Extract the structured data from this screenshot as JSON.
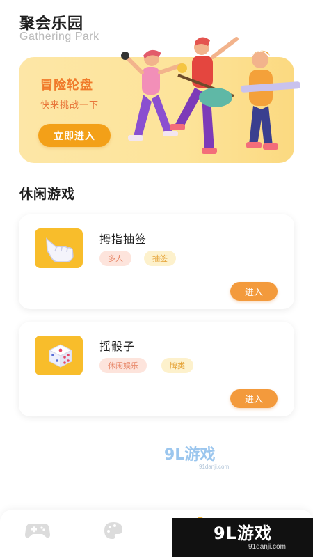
{
  "header": {
    "title": "聚会乐园",
    "subtitle": "Gathering Park"
  },
  "banner": {
    "title": "冒险轮盘",
    "subtitle": "快来挑战一下",
    "button_label": "立即进入"
  },
  "section": {
    "title": "休闲游戏"
  },
  "games": [
    {
      "name": "拇指抽签",
      "tags": [
        "多人",
        "抽签"
      ],
      "enter_label": "进入",
      "icon": "pointing-hand-icon"
    },
    {
      "name": "摇骰子",
      "tags": [
        "休闲娱乐",
        "牌类"
      ],
      "enter_label": "进入",
      "icon": "dice-icon"
    }
  ],
  "watermark": {
    "main": "9L游戏",
    "url": "91danji.com"
  },
  "bottom_nav": {
    "items": [
      {
        "icon": "gamepad-icon"
      },
      {
        "icon": "palette-icon"
      },
      {
        "icon": "home-icon"
      }
    ]
  },
  "corner_badge": {
    "main": "9L游戏",
    "url": "91danji.com"
  },
  "colors": {
    "accent_orange": "#f39a3c",
    "banner_bg": "#fde49a",
    "thumb_yellow": "#f8bd2b"
  }
}
